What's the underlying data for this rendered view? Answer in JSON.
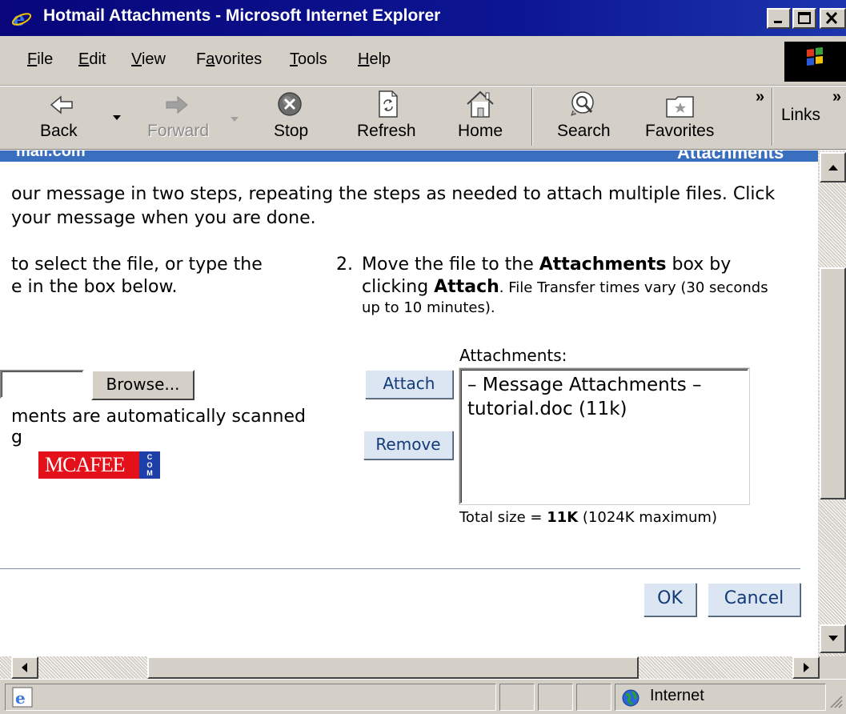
{
  "window": {
    "title": "Hotmail Attachments - Microsoft Internet Explorer"
  },
  "menu": [
    {
      "pre": "",
      "key": "F",
      "post": "ile"
    },
    {
      "pre": "",
      "key": "E",
      "post": "dit"
    },
    {
      "pre": "",
      "key": "V",
      "post": "iew"
    },
    {
      "pre": "F",
      "key": "a",
      "post": "vorites"
    },
    {
      "pre": "",
      "key": "T",
      "post": "ools"
    },
    {
      "pre": "",
      "key": "H",
      "post": "elp"
    }
  ],
  "toolbar": {
    "back": "Back",
    "forward": "Forward",
    "stop": "Stop",
    "refresh": "Refresh",
    "home": "Home",
    "search": "Search",
    "favorites": "Favorites",
    "chevron": "»",
    "links": "Links",
    "links_chevron": "»"
  },
  "header": {
    "left": "mail.com",
    "right": "Attachments"
  },
  "intro": {
    "line1": "our message in two steps, repeating the steps as needed to attach multiple files. Click",
    "line2": "your message when you are done."
  },
  "step1": {
    "line1": "to select the file, or type the",
    "line2": "e in the box below.",
    "browse_button": "Browse...",
    "scan_line1": "ments are automatically scanned",
    "scan_line2": "g",
    "mcafee_logo": "MCAFEE",
    "mcafee_tag": "COM"
  },
  "step2": {
    "number": "2.",
    "line1_pre": "Move the file to the ",
    "line1_bold": "Attachments",
    "line1_post": " box by",
    "line2_pre": "clicking ",
    "line2_bold": "Attach",
    "line2_post": ". File Transfer times vary (30 seconds",
    "line3": "up to 10 minutes).",
    "attach_button": "Attach",
    "remove_button": "Remove",
    "attachments_label": "Attachments:",
    "attachments_list": [
      "– Message Attachments –",
      "tutorial.doc (11k)"
    ],
    "total_pre": "Total size = ",
    "total_bold": "11K",
    "total_post": " (1024K maximum)"
  },
  "actions": {
    "ok": "OK",
    "cancel": "Cancel"
  },
  "status": {
    "zone": "Internet"
  },
  "colors": {
    "title_bar": "#0c1592",
    "header_band": "#3a6fbf",
    "button_face": "#dbe6f2",
    "mcafee_red": "#e4101a"
  }
}
